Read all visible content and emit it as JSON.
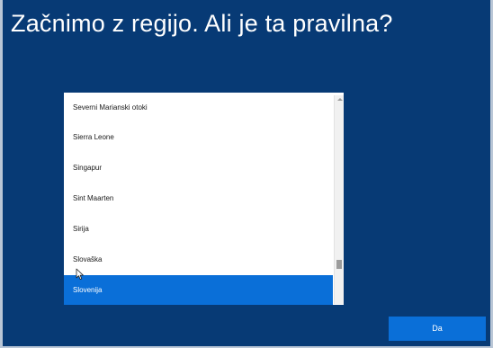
{
  "page": {
    "title": "Začnimo z regijo. Ali je ta pravilna?"
  },
  "region_list": {
    "items": [
      {
        "label": "Severni Marianski otoki"
      },
      {
        "label": "Sierra Leone"
      },
      {
        "label": "Singapur"
      },
      {
        "label": "Sint Maarten"
      },
      {
        "label": "Sirija"
      },
      {
        "label": "Slovaška"
      },
      {
        "label": "Slovenija"
      }
    ],
    "selected": "Slovenija"
  },
  "footer": {
    "confirm_label": "Da"
  },
  "colors": {
    "background": "#073a75",
    "accent": "#0a6fd8",
    "list_background": "#ffffff"
  }
}
